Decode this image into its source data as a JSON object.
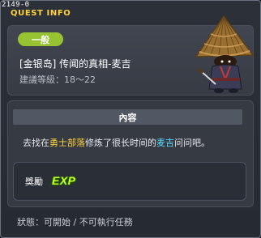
{
  "window": {
    "id_text": "2149-0",
    "title": "QUEST INFO"
  },
  "quest": {
    "category_badge": "一般",
    "name": "[金银岛] 传闻的真相-麦吉",
    "level_requirement": "建議等級：18～22"
  },
  "content": {
    "header": "內容",
    "description": {
      "part1": "去找在",
      "location": "勇士部落",
      "part2": "修炼了很长时间的",
      "npc": "麦吉",
      "part3": "问问吧。"
    }
  },
  "reward": {
    "label": "獎勵",
    "exp_text": "EXP"
  },
  "status": "狀態：可開始 / 不可執行任務",
  "colors": {
    "title": "#ffd23c",
    "badge": "#97c332",
    "location_highlight": "#ffd23c",
    "npc_highlight": "#59d9ff",
    "exp": "#c7ff2a"
  }
}
